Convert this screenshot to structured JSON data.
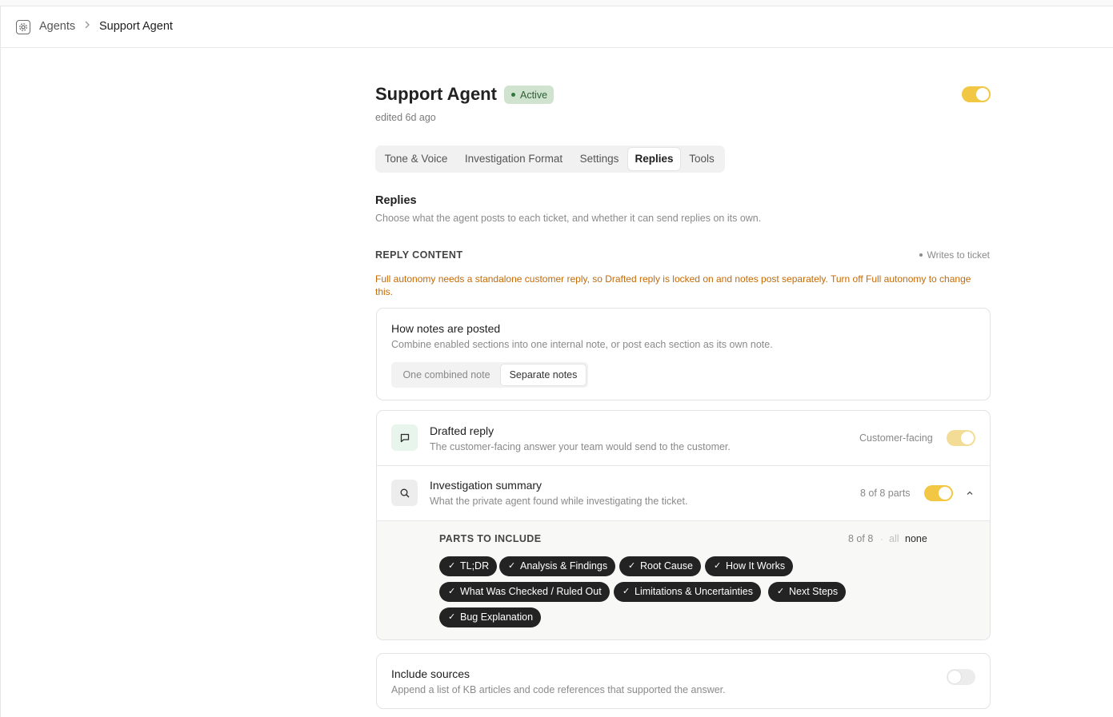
{
  "breadcrumb": {
    "root": "Agents",
    "current": "Support Agent"
  },
  "agent": {
    "name": "Support Agent",
    "status": "Active",
    "edited": "edited 6d ago",
    "enabled": true
  },
  "tabs": [
    {
      "label": "Tone & Voice",
      "active": false
    },
    {
      "label": "Investigation Format",
      "active": false
    },
    {
      "label": "Settings",
      "active": false
    },
    {
      "label": "Replies",
      "active": true
    },
    {
      "label": "Tools",
      "active": false
    }
  ],
  "replies": {
    "title": "Replies",
    "description": "Choose what the agent posts to each ticket, and whether it can send replies on its own.",
    "reply_content_label": "REPLY CONTENT",
    "writes_to_ticket": "Writes to ticket",
    "warning": "Full autonomy needs a standalone customer reply, so Drafted reply is locked on and notes post separately. Turn off Full autonomy to change this."
  },
  "notes_card": {
    "title": "How notes are posted",
    "description": "Combine enabled sections into one internal note, or post each section as its own note.",
    "options": [
      "One combined note",
      "Separate notes"
    ],
    "selected": "Separate notes"
  },
  "drafted_reply": {
    "title": "Drafted reply",
    "description": "The customer-facing answer your team would send to the customer.",
    "tag": "Customer-facing",
    "enabled": true
  },
  "investigation_summary": {
    "title": "Investigation summary",
    "description": "What the private agent found while investigating the ticket.",
    "parts_count": "8 of 8 parts",
    "enabled": true,
    "parts_label": "PARTS TO INCLUDE",
    "parts_selected": "8 of 8",
    "select_all": "all",
    "select_none": "none",
    "separator": "·",
    "parts": [
      "TL;DR",
      "Analysis & Findings",
      "Root Cause",
      "How It Works",
      "What Was Checked / Ruled Out",
      "Limitations & Uncertainties",
      "Next Steps",
      "Bug Explanation"
    ]
  },
  "include_sources": {
    "title": "Include sources",
    "description": "Append a list of KB articles and code references that supported the answer.",
    "enabled": false
  },
  "colors": {
    "accent_toggle": "#f2c744",
    "warning": "#c56a06",
    "badge_bg": "#cfe3cf",
    "chip_bg": "#232323"
  },
  "icons": {
    "app": "agent-gear-icon",
    "breadcrumb_sep": "chevron-right-icon",
    "drafted": "chat-bubble-icon",
    "investigation": "search-icon",
    "collapse": "chevron-up-icon",
    "check": "check-icon"
  }
}
